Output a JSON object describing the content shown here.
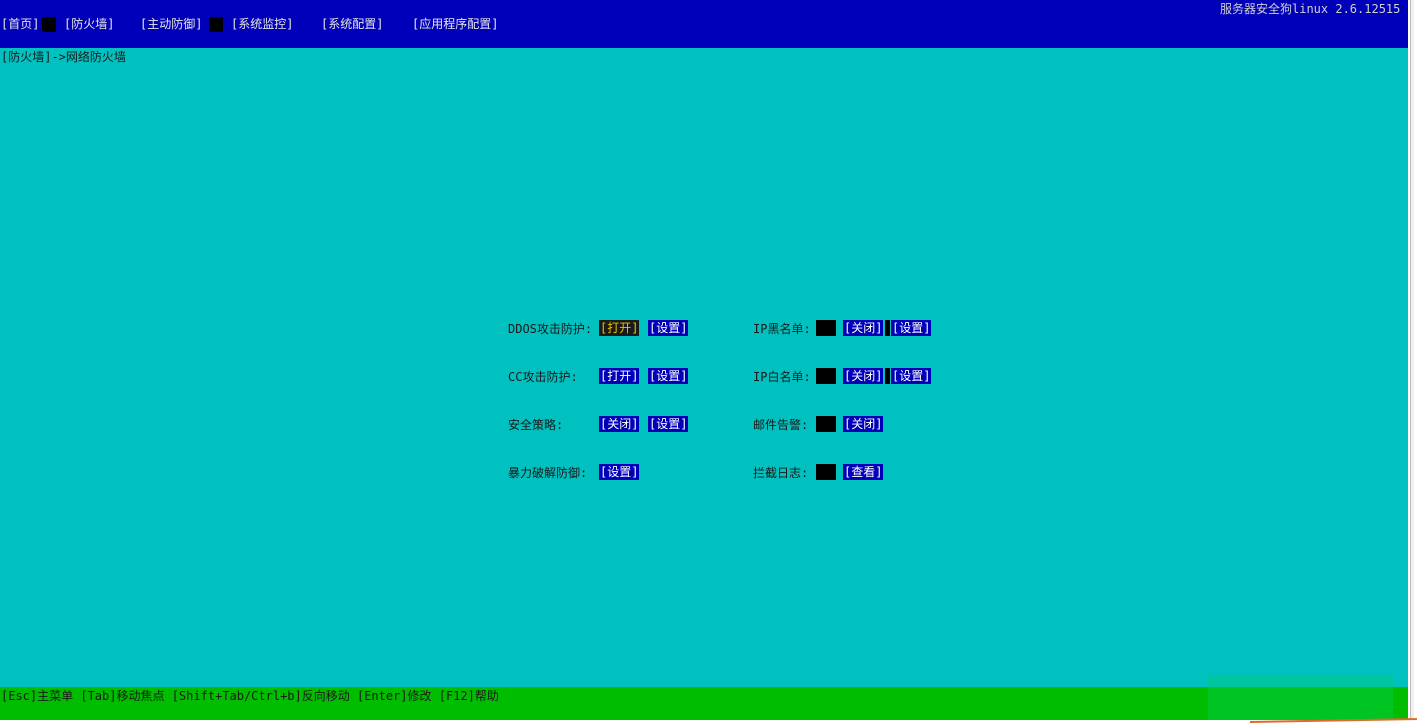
{
  "app": {
    "version_title": "服务器安全狗linux 2.6.12515"
  },
  "menu": {
    "items": [
      {
        "label": "[首页]"
      },
      {
        "label": "[防火墙]"
      },
      {
        "label": "[主动防御]"
      },
      {
        "label": "[系统监控]"
      },
      {
        "label": "[系统配置]"
      },
      {
        "label": "[应用程序配置]"
      }
    ]
  },
  "breadcrumb": "[防火墙]->网络防火墙",
  "firewall": {
    "left": [
      {
        "label": "DDOS攻击防护:",
        "toggle": "[打开]",
        "settings": "[设置]"
      },
      {
        "label": "CC攻击防护:",
        "toggle": "[打开]",
        "settings": "[设置]"
      },
      {
        "label": "安全策略:",
        "toggle": "[关闭]",
        "settings": "[设置]"
      },
      {
        "label": "暴力破解防御:",
        "settings": "[设置]"
      }
    ],
    "right": [
      {
        "label": "IP黑名单:",
        "toggle": "[关闭]",
        "settings": "[设置]"
      },
      {
        "label": "IP白名单:",
        "toggle": "[关闭]",
        "settings": "[设置]"
      },
      {
        "label": "邮件告警:",
        "toggle": "[关闭]"
      },
      {
        "label": "拦截日志:",
        "view": "[查看]"
      }
    ]
  },
  "status_bar": {
    "hints": "[Esc]主菜单 [Tab]移动焦点 [Shift+Tab/Ctrl+b]反向移动 [Enter]修改 [F12]帮助"
  },
  "colors": {
    "terminal_bg": "#00c0c0",
    "menu_bg": "#0000b8",
    "status_bg": "#00bd00",
    "focus_fg": "#e8c100"
  }
}
